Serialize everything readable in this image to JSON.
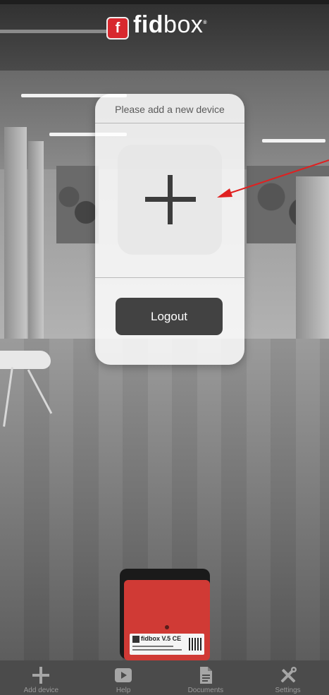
{
  "header": {
    "logo_mark": "f",
    "logo_bold": "fid",
    "logo_light": "box",
    "logo_reg": "®",
    "brand_color": "#d8282e"
  },
  "card": {
    "title": "Please add a new device",
    "add_icon": "plus-icon",
    "logout_label": "Logout"
  },
  "annotation": {
    "arrow_color": "#e02020"
  },
  "device": {
    "label_text": "fidbox V.5  CE"
  },
  "nav": {
    "items": [
      {
        "label": "Add device",
        "icon": "plus-icon"
      },
      {
        "label": "Help",
        "icon": "play-icon"
      },
      {
        "label": "Documents",
        "icon": "document-icon"
      },
      {
        "label": "Settings",
        "icon": "tools-icon"
      }
    ]
  }
}
